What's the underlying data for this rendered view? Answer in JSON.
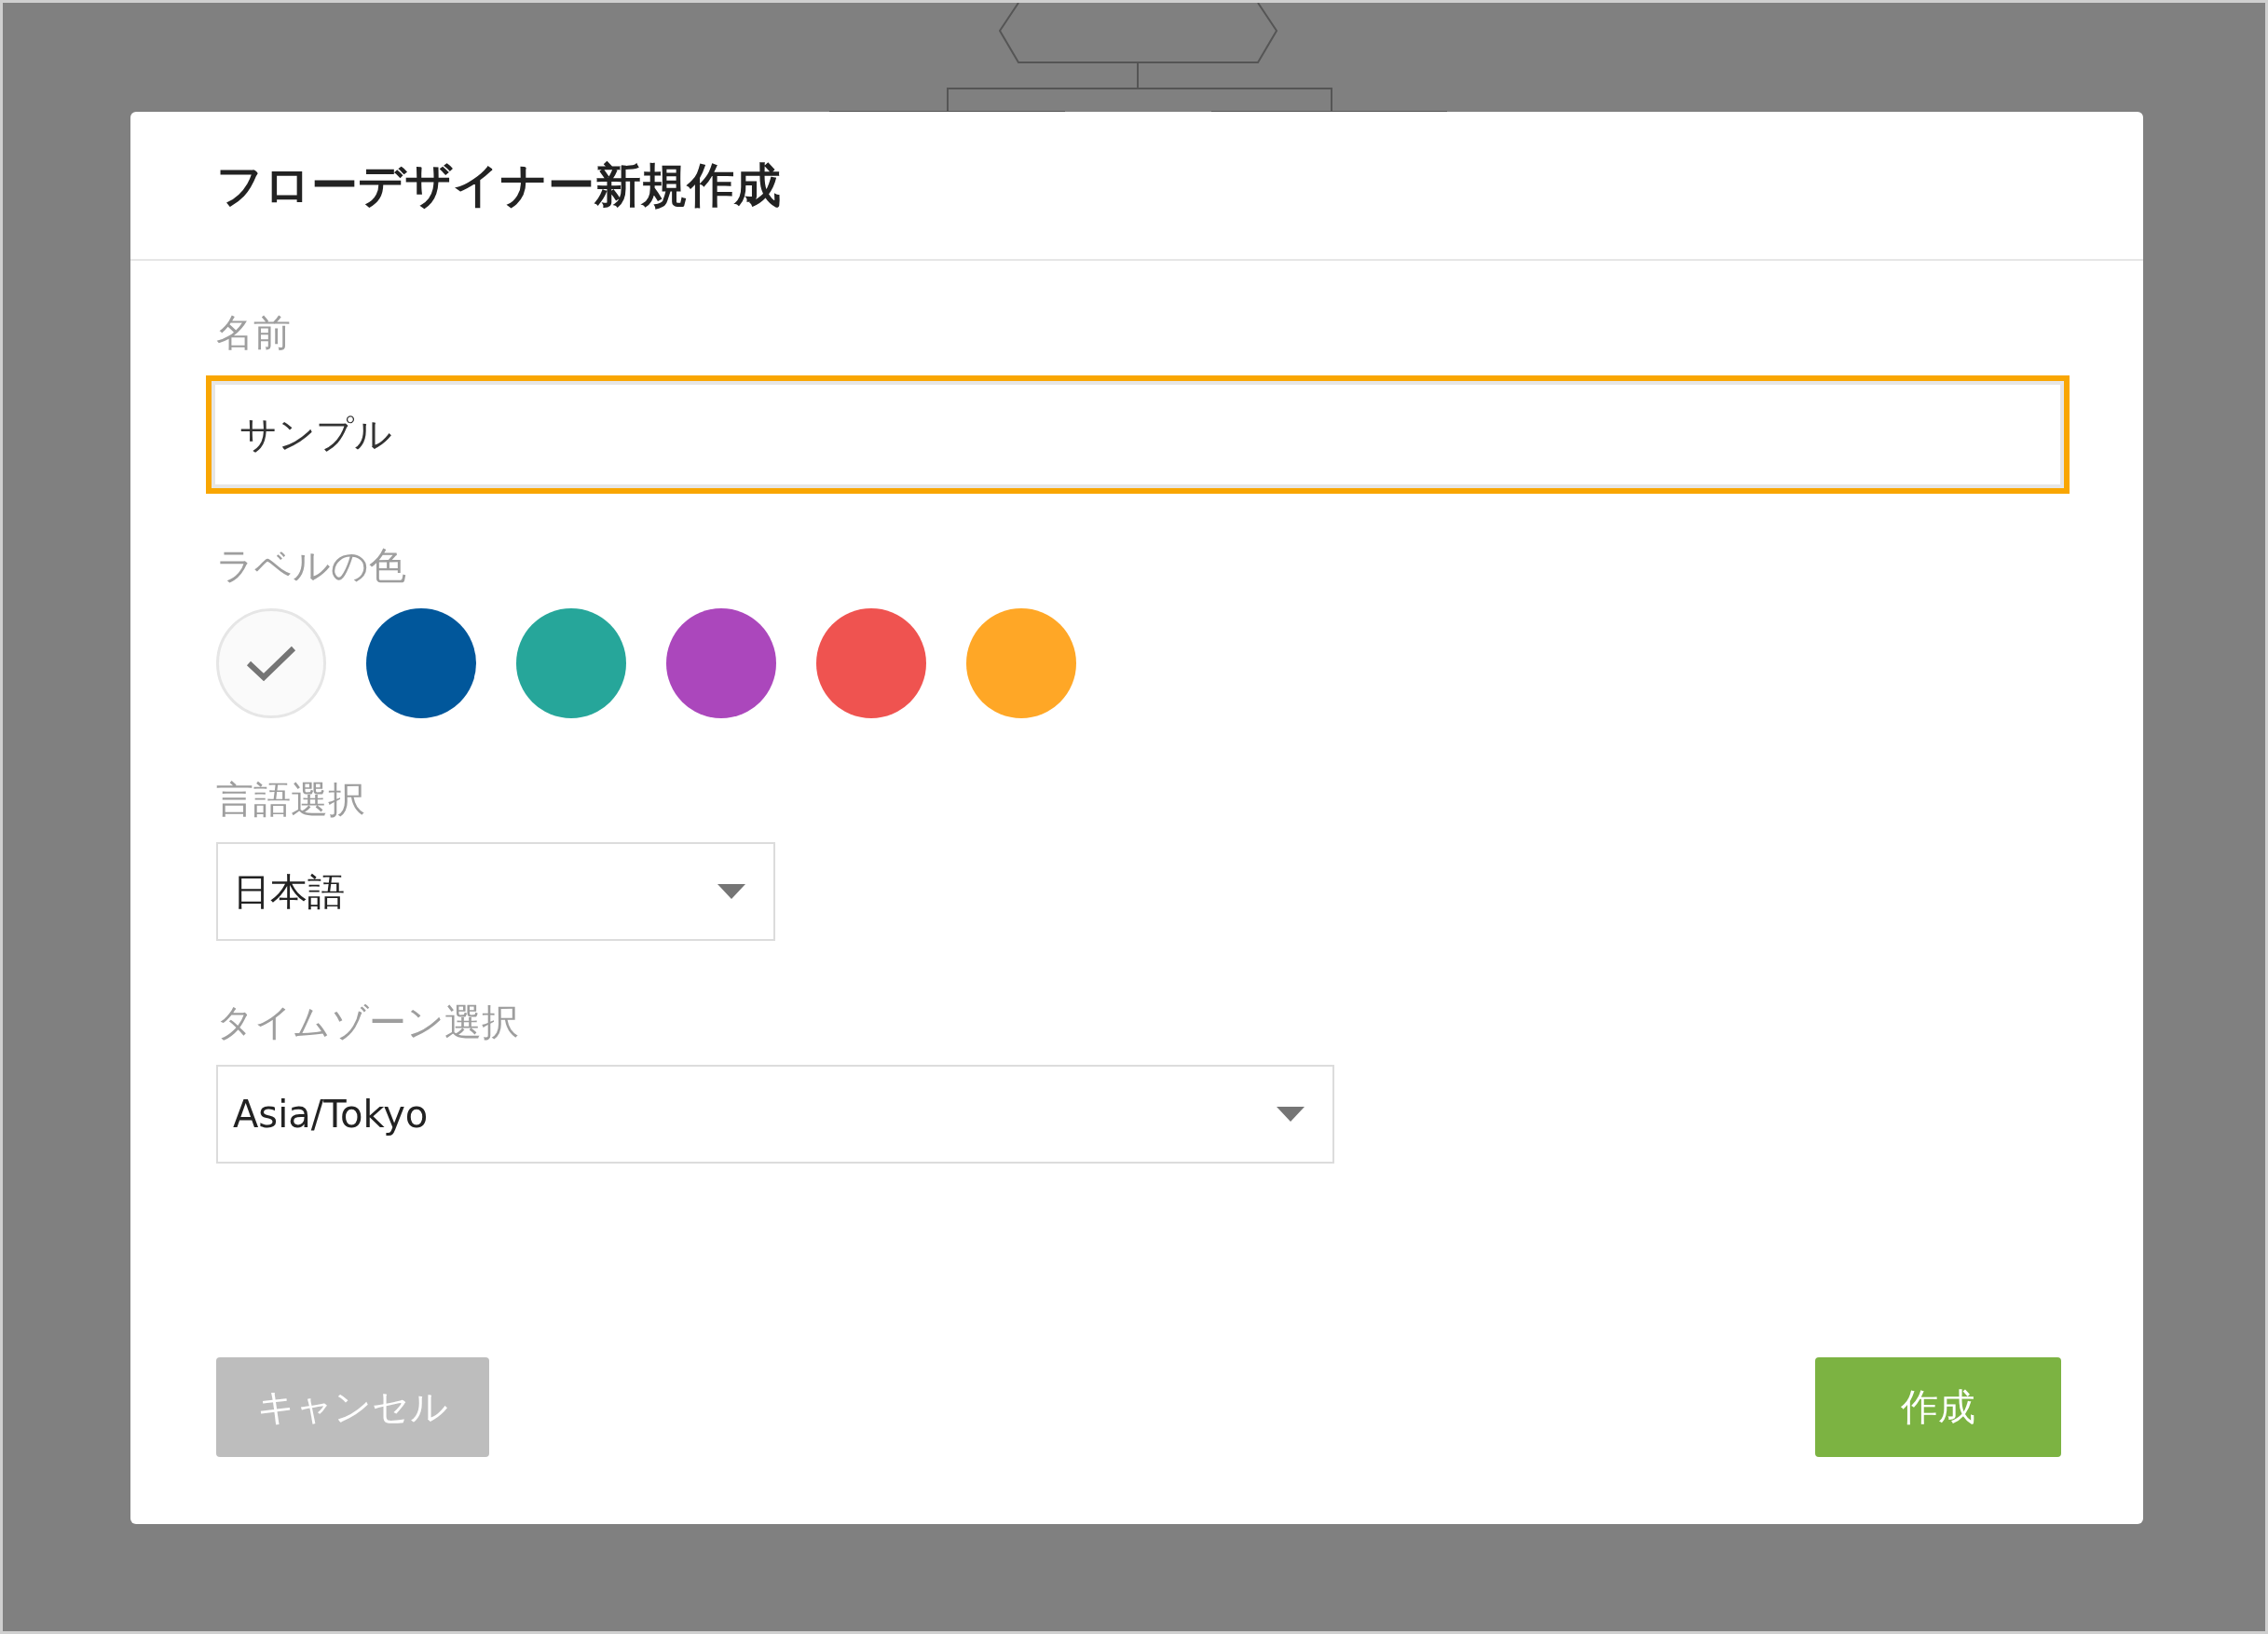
{
  "dialog": {
    "title": "フローデザイナー新規作成"
  },
  "name_field": {
    "label": "名前",
    "value": "サンプル"
  },
  "label_color": {
    "label": "ラベルの色",
    "swatches": [
      {
        "color": "#fafafa",
        "selected": true
      },
      {
        "color": "#01579b",
        "selected": false
      },
      {
        "color": "#26a69a",
        "selected": false
      },
      {
        "color": "#ab47bc",
        "selected": false
      },
      {
        "color": "#ef5350",
        "selected": false
      },
      {
        "color": "#ffa726",
        "selected": false
      }
    ]
  },
  "language": {
    "label": "言語選択",
    "value": "日本語"
  },
  "timezone": {
    "label": "タイムゾーン選択",
    "value": "Asia/Tokyo"
  },
  "buttons": {
    "cancel": "キャンセル",
    "create": "作成"
  }
}
